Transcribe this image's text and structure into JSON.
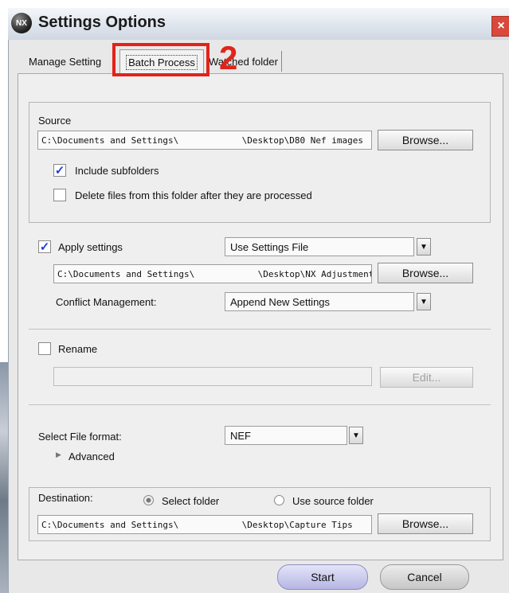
{
  "window": {
    "title": "Settings Options",
    "icon_text": "NX",
    "close_glyph": "×"
  },
  "tabs": [
    {
      "label": "Manage Setting"
    },
    {
      "label": "Batch Process"
    },
    {
      "label": "Watched folder"
    }
  ],
  "annotation": {
    "number": "2",
    "color": "#e2231a"
  },
  "source": {
    "heading": "Source",
    "path": "C:\\Documents and Settings\\            \\Desktop\\D80 Nef images",
    "browse_label": "Browse...",
    "include_subfolders": {
      "label": "Include subfolders",
      "checked": true,
      "mark": "✓"
    },
    "delete_files": {
      "label": "Delete files from this folder after they are processed",
      "checked": false
    }
  },
  "apply": {
    "label": "Apply settings",
    "checked": true,
    "mark": "✓",
    "mode_value": "Use Settings File",
    "path": "C:\\Documents and Settings\\            \\Desktop\\NX Adjustment\\Size",
    "browse_label": "Browse...",
    "conflict_label": "Conflict Management:",
    "conflict_value": "Append New Settings"
  },
  "rename": {
    "label": "Rename",
    "checked": false,
    "value": "",
    "edit_label": "Edit..."
  },
  "format": {
    "label": "Select File format:",
    "value": "NEF",
    "advanced_label": "Advanced",
    "advanced_glyph": "▶"
  },
  "destination": {
    "label": "Destination:",
    "option_select": "Select folder",
    "option_source": "Use source folder",
    "selected": "select",
    "path": "C:\\Documents and Settings\\            \\Desktop\\Capture Tips",
    "browse_label": "Browse..."
  },
  "footer": {
    "start_label": "Start",
    "cancel_label": "Cancel"
  },
  "dropdown_glyph": "▼"
}
